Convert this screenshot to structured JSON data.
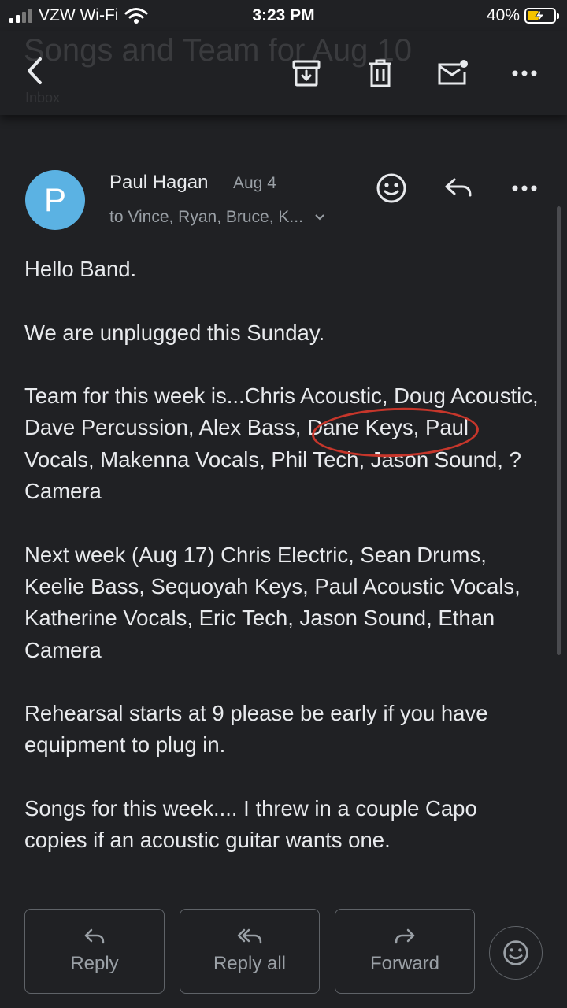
{
  "status_bar": {
    "carrier": "VZW Wi-Fi",
    "time": "3:23 PM",
    "battery": "40%"
  },
  "app_bar": {
    "subject": "Songs and Team for Aug 10",
    "label": "Inbox"
  },
  "message": {
    "sender_initial": "P",
    "sender": "Paul Hagan",
    "date": "Aug 4",
    "recipients": "to Vince, Ryan, Bruce, K...",
    "paragraphs": [
      "Hello Band.",
      "We are unplugged this Sunday.",
      "Team for this week is...Chris Acoustic, Doug Acoustic, Dave Percussion, Alex Bass, Dane Keys, Paul Vocals, Makenna Vocals, Phil Tech, Jason Sound, ? Camera",
      "Next week (Aug 17) Chris Electric, Sean Drums, Keelie Bass, Sequoyah Keys, Paul Acoustic Vocals, Katherine Vocals, Eric Tech, Jason Sound, Ethan Camera",
      "Rehearsal starts at 9 please be early if you have equipment to plug in.",
      "Songs for this week.... I threw in a couple Capo copies if an acoustic guitar wants one."
    ]
  },
  "actions": {
    "reply": "Reply",
    "reply_all": "Reply all",
    "forward": "Forward"
  },
  "colors": {
    "background": "#202124",
    "avatar": "#5bb2e3",
    "annotation": "#c6362b"
  }
}
